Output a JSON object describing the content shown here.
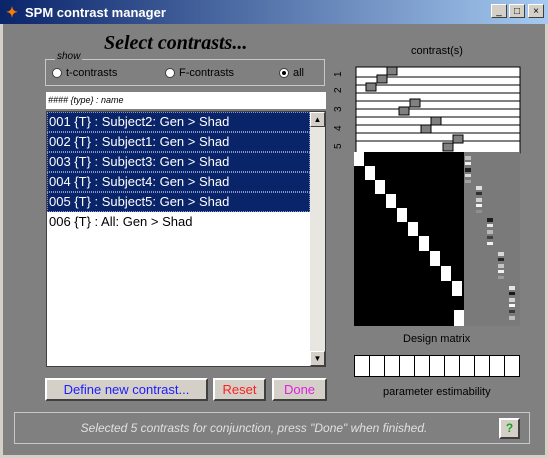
{
  "window": {
    "title": "SPM contrast manager",
    "icon": "matlab-logo-icon",
    "controls": [
      "_",
      "□",
      "×"
    ]
  },
  "heading": "Select contrasts...",
  "filter": {
    "legend": "show",
    "options": [
      {
        "label": "t-contrasts",
        "selected": false
      },
      {
        "label": "F-contrasts",
        "selected": false
      },
      {
        "label": "all",
        "selected": true
      }
    ]
  },
  "list": {
    "header": "#### {type} : name",
    "items": [
      {
        "label": "001 {T} : Subject2: Gen > Shad",
        "selected": true
      },
      {
        "label": "002 {T} : Subject1: Gen > Shad",
        "selected": true
      },
      {
        "label": "003 {T} : Subject3: Gen > Shad",
        "selected": true
      },
      {
        "label": "004 {T} : Subject4: Gen > Shad",
        "selected": true
      },
      {
        "label": "005 {T} : Subject5: Gen > Shad",
        "selected": true
      },
      {
        "label": "006 {T} : All: Gen > Shad",
        "selected": false
      }
    ]
  },
  "buttons": {
    "define": {
      "label": "Define new contrast...",
      "color": "#1c1cff"
    },
    "reset": {
      "label": "Reset",
      "color": "#ff2020"
    },
    "done": {
      "label": "Done",
      "color": "#e020e0"
    }
  },
  "panels": {
    "contrasts_label": "contrast(s)",
    "contrast_numbers": [
      "1",
      "2",
      "3",
      "4",
      "5"
    ],
    "design_matrix_label": "Design matrix",
    "estimability_label": "parameter estimability"
  },
  "status": {
    "text": "Selected 5 contrasts for conjunction, press \"Done\" when finished.",
    "help_label": "?"
  }
}
